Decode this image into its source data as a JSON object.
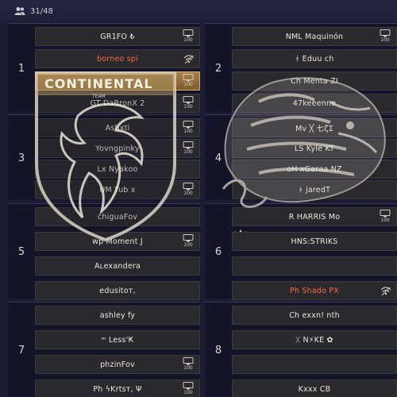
{
  "header": {
    "player_count": "31/48",
    "icon": "users-icon"
  },
  "groups": [
    {
      "number": "1",
      "slots": [
        {
          "name": "GR1FO  ₺",
          "device": "100"
        },
        {
          "name": "borneo  spi",
          "orange": true,
          "signal": true
        },
        {
          "name": "",
          "highlight": true,
          "device": "100"
        },
        {
          "name": "GT  DaBronX  2",
          "device": "100"
        }
      ]
    },
    {
      "number": "2",
      "slots": [
        {
          "name": "NML  Maquinón",
          "device": "100"
        },
        {
          "name": "ᚼ  Eduu  ch"
        },
        {
          "name": "Ch  Menta  ZI"
        },
        {
          "name": "47keeenne"
        }
      ]
    },
    {
      "number": "3",
      "crown": true,
      "slots": [
        {
          "name": "Ashxti",
          "device": "100"
        },
        {
          "name": "Yovngpinky",
          "device": "100"
        },
        {
          "name": "Lx  Nyakoo"
        },
        {
          "name": "UM  Yub  x",
          "device": "100"
        }
      ]
    },
    {
      "number": "4",
      "slots": [
        {
          "name": "Mv  ╳ 七ζΣ"
        },
        {
          "name": "LS  Kyle  KT"
        },
        {
          "name": "oH  xGaraa  NZ"
        },
        {
          "name": "ᚼ  jaredT"
        }
      ]
    },
    {
      "number": "5",
      "slots": [
        {
          "name": "chiguaFov"
        },
        {
          "name": "wp  Moment  J",
          "device": "100"
        },
        {
          "name": "Aʟexandera"
        },
        {
          "name": "edusitoт,"
        }
      ]
    },
    {
      "number": "6",
      "crown": true,
      "slots": [
        {
          "name": "R  HARRIS  Mo",
          "device": "100"
        },
        {
          "name": "HNS:STRIKS"
        },
        {
          "name": ""
        },
        {
          "name": "Ph  Shado  PX",
          "orange": true,
          "signal": true
        }
      ]
    },
    {
      "number": "7",
      "crown": true,
      "slots": [
        {
          "name": "ashley  fy"
        },
        {
          "name": "ᵐ  Less'Ҝ"
        },
        {
          "name": "phzinFov",
          "device": "100"
        },
        {
          "name": "Ph  ϟKrtsт,  Ψ",
          "device": "100"
        }
      ]
    },
    {
      "number": "8",
      "slots": [
        {
          "name": "Ch  exxn!  nth"
        },
        {
          "name": "ᚷ  N⚡KE  ✿"
        },
        {
          "name": ""
        },
        {
          "name": "Kxxx  CB"
        }
      ]
    }
  ],
  "overlay": {
    "logo_text": "CONTINENTAL",
    "logo_subtext": "TEAM"
  },
  "colors": {
    "background": "#1d1b34",
    "slot": "#2a2a2e",
    "orange_name": "#ff6a3c",
    "highlight": "#a9814a"
  }
}
